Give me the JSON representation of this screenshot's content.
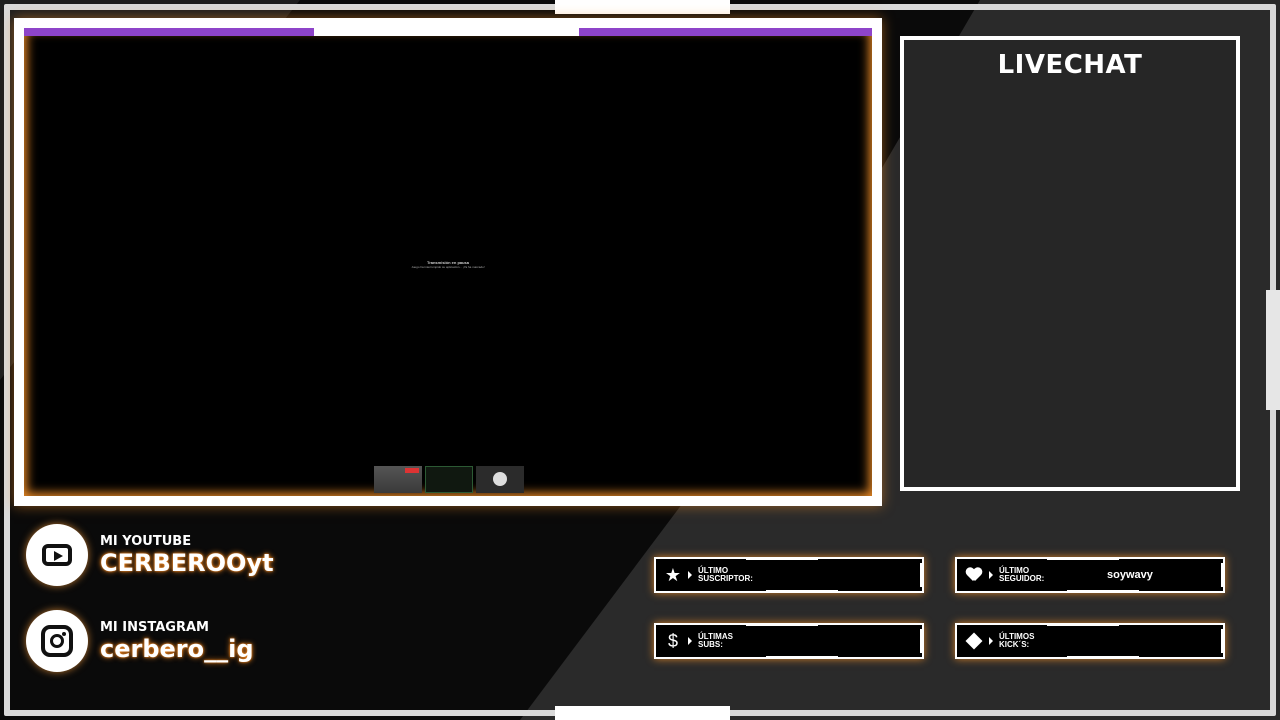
{
  "game": {
    "stream_title": "Transmisión en pausa",
    "stream_sub": "Juego ha interrumpido su aplicación... ¡Ya ha marcado!"
  },
  "livechat": {
    "title": "LIVECHAT"
  },
  "socials": {
    "youtube": {
      "label": "MI YOUTUBE",
      "handle": "CERBEROOyt",
      "icon": "youtube-icon"
    },
    "instagram": {
      "label": "MI INSTAGRAM",
      "handle": "cerbero__ig",
      "icon": "instagram-icon"
    }
  },
  "alerts": {
    "subscriber": {
      "label_line1": "ÚLTIMO",
      "label_line2": "SUSCRIPTOR:",
      "value": "",
      "icon": "star-icon"
    },
    "follower": {
      "label_line1": "ÚLTIMO",
      "label_line2": "SEGUIDOR:",
      "value": "soywavy",
      "icon": "heart-icon"
    },
    "subs": {
      "label_line1": "ÚLTIMAS",
      "label_line2": "SUBS:",
      "value": "",
      "icon": "dollar-icon"
    },
    "kicks": {
      "label_line1": "ÚLTIMOS",
      "label_line2": "KICK´S:",
      "value": "",
      "icon": "diamond-icon"
    }
  },
  "colors": {
    "accent": "#ff9628",
    "purple": "#8e44c9",
    "frame": "#ffffff"
  }
}
